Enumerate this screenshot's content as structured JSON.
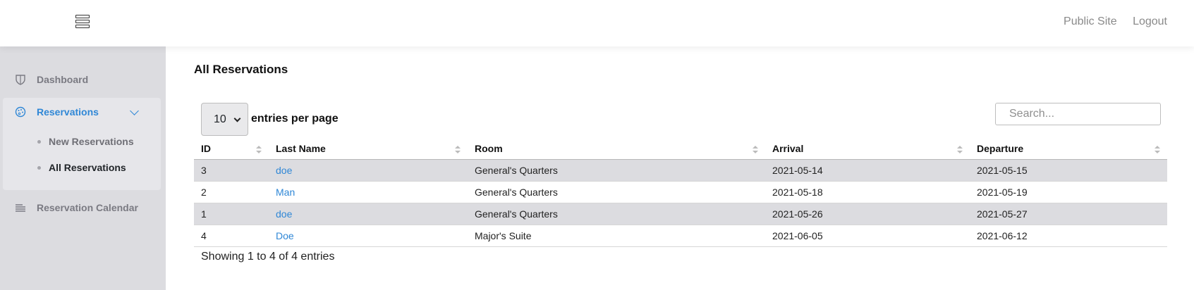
{
  "topbar": {
    "menu_icon": "hamburger-icon",
    "links": [
      "Public Site",
      "Logout"
    ]
  },
  "sidebar": {
    "dashboard": {
      "label": "Dashboard",
      "icon": "shield-icon"
    },
    "reservations": {
      "label": "Reservations",
      "icon": "palette-icon",
      "expanded": true
    },
    "sub_items": [
      {
        "label": "New Reservations",
        "active": false
      },
      {
        "label": "All Reservations",
        "active": true
      }
    ],
    "calendar": {
      "label": "Reservation Calendar",
      "icon": "list-lines-icon"
    }
  },
  "main": {
    "title": "All Reservations",
    "length_select": {
      "value": "10",
      "label": "entries per page"
    },
    "search": {
      "placeholder": "Search..."
    },
    "table": {
      "headers": [
        "ID",
        "Last Name",
        "Room",
        "Arrival",
        "Departure"
      ],
      "rows": [
        {
          "id": "3",
          "last_name": "doe",
          "room": "General's Quarters",
          "arrival": "2021-05-14",
          "departure": "2021-05-15"
        },
        {
          "id": "2",
          "last_name": "Man",
          "room": "General's Quarters",
          "arrival": "2021-05-18",
          "departure": "2021-05-19"
        },
        {
          "id": "1",
          "last_name": "doe",
          "room": "General's Quarters",
          "arrival": "2021-05-26",
          "departure": "2021-05-27"
        },
        {
          "id": "4",
          "last_name": "Doe",
          "room": "Major's Suite",
          "arrival": "2021-06-05",
          "departure": "2021-06-12"
        }
      ]
    },
    "info": "Showing 1 to 4 of 4 entries"
  },
  "colors": {
    "accent": "#2f87d6",
    "sidebar_bg": "#dcdce0",
    "stripe": "#dcdce0"
  }
}
